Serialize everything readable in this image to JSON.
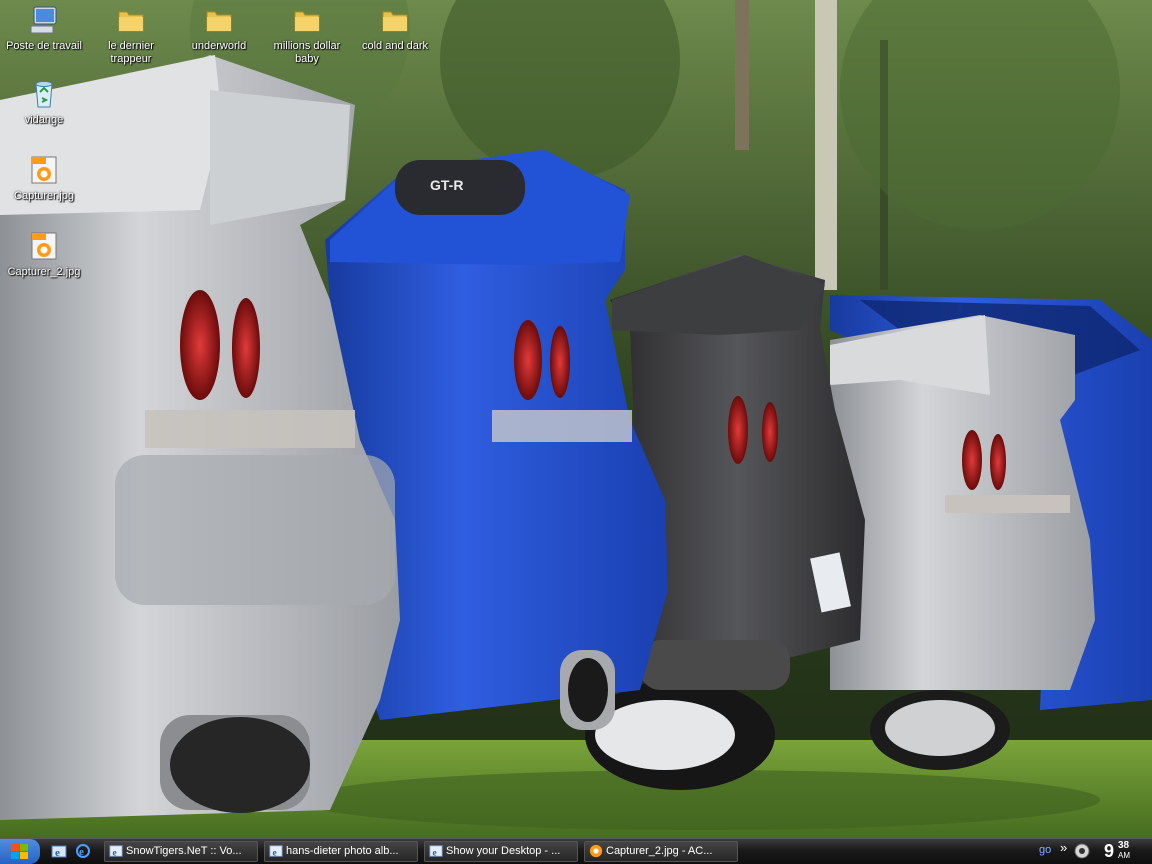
{
  "desktop": {
    "icons": [
      {
        "label": "Poste de travail",
        "icon": "my-computer-icon"
      },
      {
        "label": "le dernier trappeur",
        "icon": "folder-icon"
      },
      {
        "label": "underworld",
        "icon": "folder-icon"
      },
      {
        "label": "millions dollar baby",
        "icon": "folder-icon"
      },
      {
        "label": "cold and dark",
        "icon": "folder-icon"
      },
      {
        "label": "vidange",
        "icon": "recycle-bin-icon"
      },
      {
        "label": "Capturer.jpg",
        "icon": "jpg-file-icon"
      },
      {
        "label": "Capturer_2.jpg",
        "icon": "jpg-file-icon"
      }
    ],
    "wallpaper": {
      "description_icon": "wallpaper-image",
      "badge_text": "GT-R"
    }
  },
  "taskbar": {
    "quick_launch": [
      {
        "icon": "internet-explorer-icon"
      },
      {
        "icon": "internet-explorer-icon"
      }
    ],
    "tasks": [
      {
        "label": "SnowTigers.NeT :: Vo...",
        "icon": "internet-explorer-icon"
      },
      {
        "label": "hans-dieter photo alb...",
        "icon": "internet-explorer-icon"
      },
      {
        "label": "Show your Desktop - ...",
        "icon": "internet-explorer-icon"
      },
      {
        "label": "Capturer_2.jpg - AC...",
        "icon": "acdsee-icon"
      }
    ],
    "address_go": "go",
    "overflow_chevron": "»",
    "clock": {
      "hour": "9",
      "minute": "38",
      "ampm": "AM"
    }
  },
  "colors": {
    "taskbar": "#1a1a1a",
    "task_button": "#333333",
    "go_link": "#7fb2ff",
    "car_silver": "#b9bcbf",
    "car_blue": "#1f48c8",
    "car_black": "#3a3a3c",
    "grass": "#5c8a2e"
  }
}
